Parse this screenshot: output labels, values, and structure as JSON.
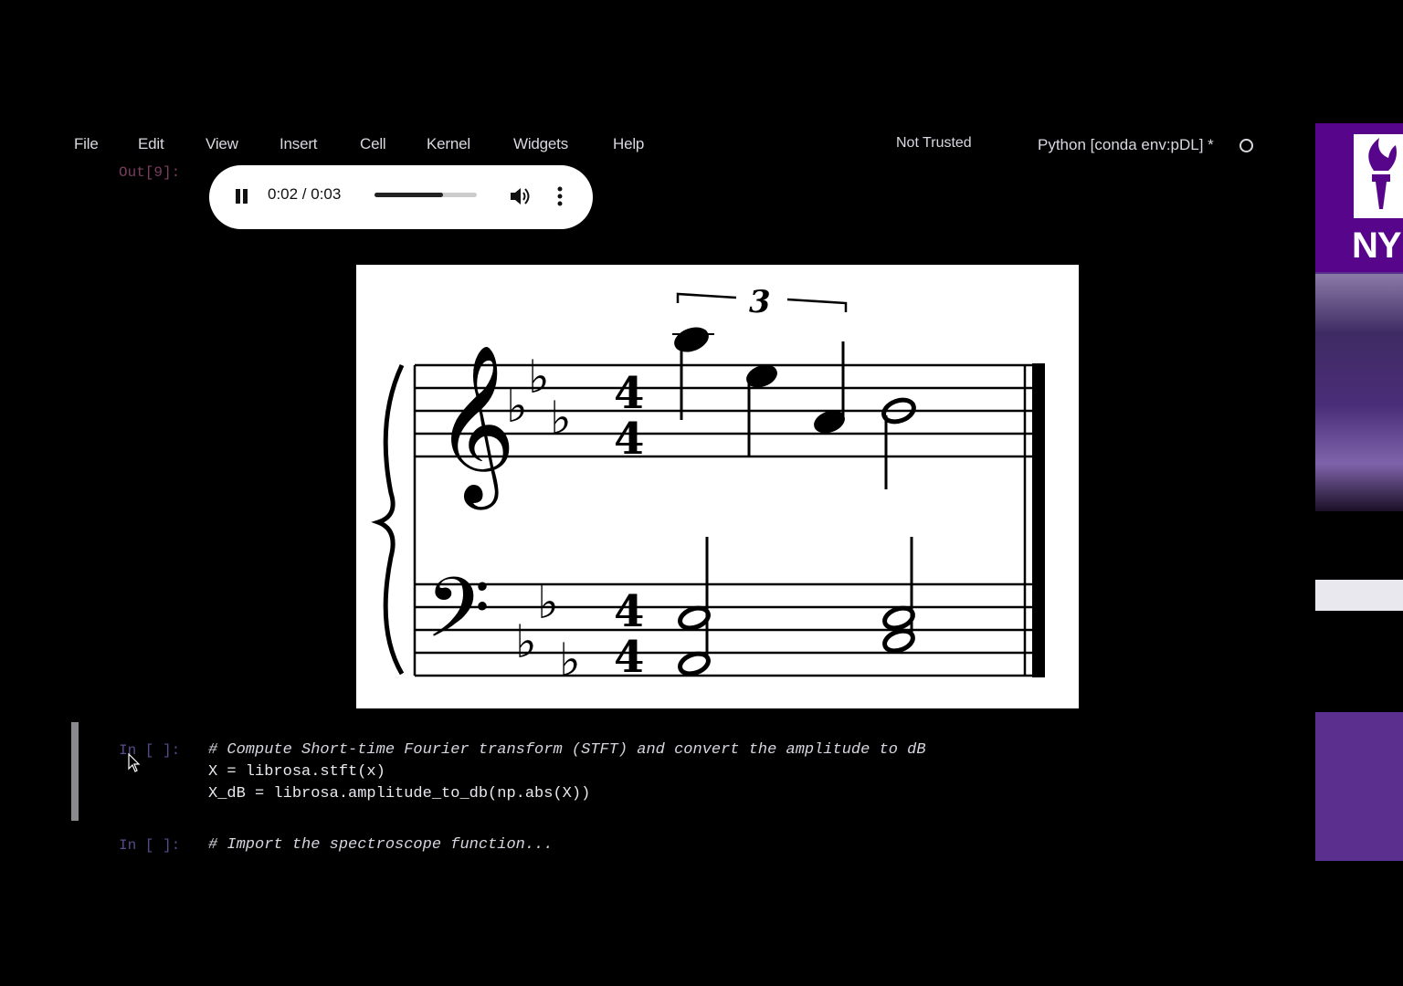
{
  "menu": {
    "items": [
      "File",
      "Edit",
      "View",
      "Insert",
      "Cell",
      "Kernel",
      "Widgets",
      "Help"
    ],
    "trust_status": "Not Trusted",
    "kernel_name": "Python [conda env:pDL] *"
  },
  "output_cell": {
    "prompt": "Out[9]:",
    "audio": {
      "time": "0:02 / 0:03",
      "progress": 0.67
    }
  },
  "score": {
    "tuplet_number": "3",
    "time_signature": [
      "4",
      "4"
    ]
  },
  "cells": [
    {
      "prompt": "In [ ]:",
      "lines": [
        "# Compute Short-time Fourier transform (STFT) and convert the amplitude to dB",
        "X = librosa.stft(x)",
        "X_dB = librosa.amplitude_to_db(np.abs(X))"
      ]
    },
    {
      "prompt": "In [ ]:",
      "lines": [
        "# Import the spectroscope function..."
      ]
    }
  ],
  "sidebar": {
    "logo_text": "NY"
  },
  "colors": {
    "background": "#000000",
    "menu_text": "#d8d8e0",
    "prompt_in": "#5a4a8a",
    "prompt_out": "#7a3e5e",
    "nyu_purple": "#57068c"
  }
}
